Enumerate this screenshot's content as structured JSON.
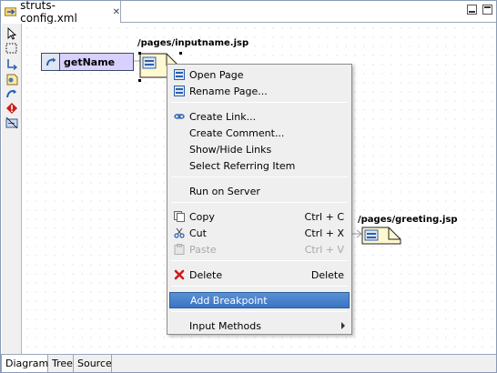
{
  "editor": {
    "tab_title": "struts-config.xml",
    "close_glyph": "✕"
  },
  "diagram": {
    "action_name": "getName",
    "pages": [
      {
        "path": "/pages/inputname.jsp"
      },
      {
        "path": "/pages/greeting.jsp"
      }
    ]
  },
  "context_menu": {
    "items": [
      {
        "label": "Open Page",
        "icon": "page-icon"
      },
      {
        "label": "Rename Page...",
        "icon": "page-icon"
      },
      {
        "label": "Create Link...",
        "icon": "link-icon"
      },
      {
        "label": "Create Comment..."
      },
      {
        "label": "Show/Hide Links"
      },
      {
        "label": "Select Referring Item"
      },
      {
        "label": "Run on Server"
      },
      {
        "label": "Copy",
        "shortcut": "Ctrl + C",
        "icon": "copy-icon"
      },
      {
        "label": "Cut",
        "shortcut": "Ctrl + X",
        "icon": "scissors-icon"
      },
      {
        "label": "Paste",
        "shortcut": "Ctrl + V",
        "icon": "paste-icon",
        "disabled": true
      },
      {
        "label": "Delete",
        "shortcut": "Delete",
        "icon": "red-x-icon"
      },
      {
        "label": "Add Breakpoint",
        "selected": true
      },
      {
        "label": "Input Methods",
        "submenu": true
      }
    ]
  },
  "bottom_tabs": [
    "Diagram",
    "Tree",
    "Source"
  ],
  "colors": {
    "selection": "#3a74c2",
    "action_label_bg": "#d8d0ff",
    "page_fill": "#fff8d0"
  }
}
